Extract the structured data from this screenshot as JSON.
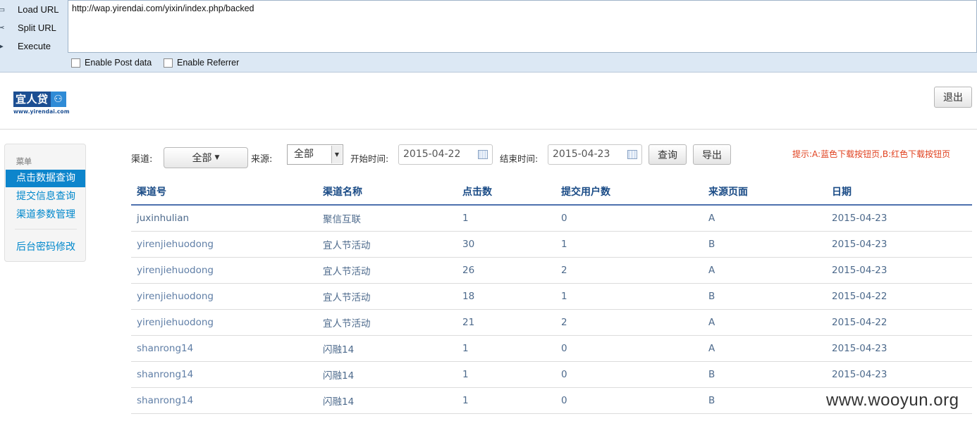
{
  "hackbar": {
    "load_url": "Load URL",
    "split_url": "Split URL",
    "execute": "Execute",
    "url_value": "http://wap.yirendai.com/yixin/index.php/backed",
    "post_label": "Enable Post data",
    "referrer_label": "Enable Referrer",
    "icons": {
      "load": "load-icon",
      "split": "scissors-icon",
      "execute": "play-icon"
    }
  },
  "header": {
    "logo_text": "宜人贷",
    "logo_url": "www.yirendai.com",
    "logout": "退出"
  },
  "sidebar": {
    "title": "菜单",
    "items": [
      {
        "label": "点击数据查询",
        "active": true
      },
      {
        "label": "提交信息查询",
        "active": false
      },
      {
        "label": "渠道参数管理",
        "active": false
      },
      {
        "label": "后台密码修改",
        "active": false
      }
    ]
  },
  "filters": {
    "channel_label": "渠道:",
    "channel_value": "全部",
    "source_label": "来源:",
    "source_value": "全部",
    "start_label": "开始时间:",
    "start_value": "2015-04-22",
    "end_label": "结束时间:",
    "end_value": "2015-04-23",
    "query_button": "查询",
    "export_button": "导出",
    "hint": "提示:A:蓝色下载按钮页,B:红色下载按钮页"
  },
  "table": {
    "columns": [
      "渠道号",
      "渠道名称",
      "点击数",
      "提交用户数",
      "来源页面",
      "日期"
    ],
    "rows": [
      [
        "juxinhulian",
        "聚信互联",
        "1",
        "0",
        "A",
        "2015-04-23"
      ],
      [
        "yirenjiehuodong",
        "宜人节活动",
        "30",
        "1",
        "B",
        "2015-04-23"
      ],
      [
        "yirenjiehuodong",
        "宜人节活动",
        "26",
        "2",
        "A",
        "2015-04-23"
      ],
      [
        "yirenjiehuodong",
        "宜人节活动",
        "18",
        "1",
        "B",
        "2015-04-22"
      ],
      [
        "yirenjiehuodong",
        "宜人节活动",
        "21",
        "2",
        "A",
        "2015-04-22"
      ],
      [
        "shanrong14",
        "闪融14",
        "1",
        "0",
        "A",
        "2015-04-23"
      ],
      [
        "shanrong14",
        "闪融14",
        "1",
        "0",
        "B",
        "2015-04-23"
      ],
      [
        "shanrong14",
        "闪融14",
        "1",
        "0",
        "B",
        ""
      ]
    ]
  },
  "watermark": "www.wooyun.org"
}
